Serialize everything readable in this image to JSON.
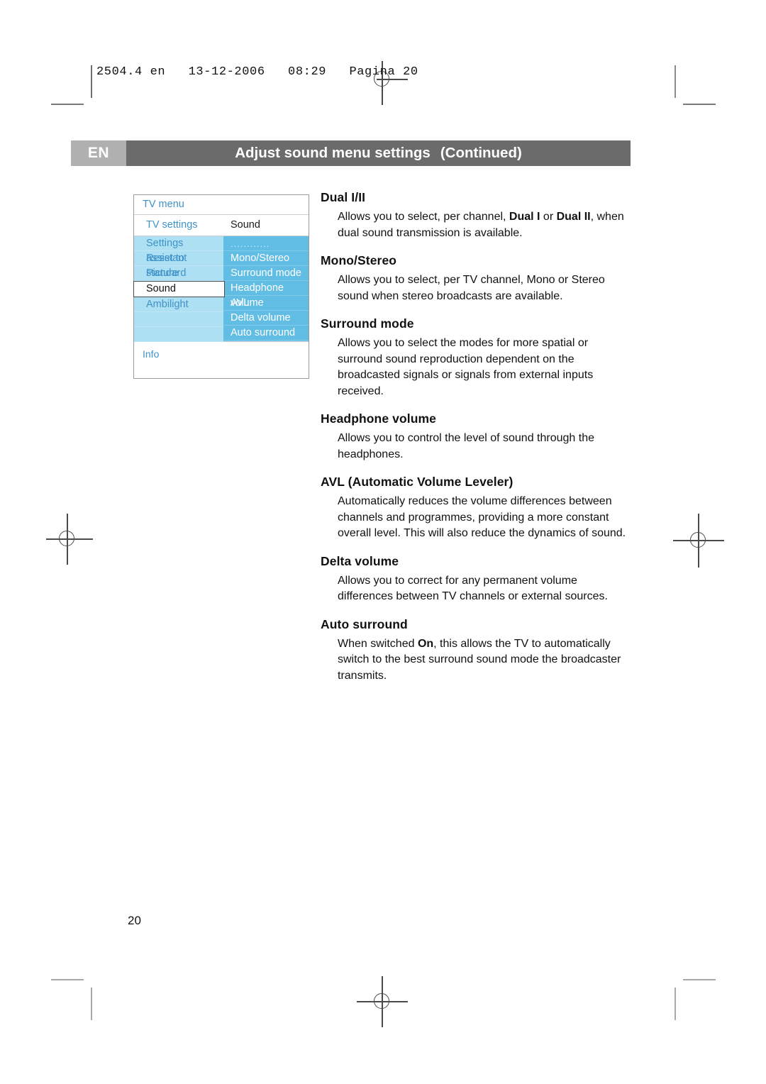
{
  "print_header": "2504.4 en   13-12-2006   08:29   Pagina 20",
  "titlebar": {
    "language": "EN",
    "title": "Adjust sound menu settings",
    "continued": "(Continued)",
    "lang_bg": "#b0b0b0",
    "title_bg": "#6b6b6b"
  },
  "tv_menu": {
    "title": "TV menu",
    "subtitle_left": "TV settings",
    "subtitle_right": "Sound",
    "left_items": [
      {
        "label": "Settings assistant",
        "selected": false
      },
      {
        "label": "Reset to standard",
        "selected": false
      },
      {
        "label": "Picture",
        "selected": false
      },
      {
        "label": "Sound",
        "selected": true
      },
      {
        "label": "Ambilight",
        "selected": false
      },
      {
        "label": "",
        "selected": false
      },
      {
        "label": "",
        "selected": false
      }
    ],
    "right_items": [
      {
        "label": "............",
        "dots": true
      },
      {
        "label": "Mono/Stereo",
        "dots": false
      },
      {
        "label": "Surround mode",
        "dots": false
      },
      {
        "label": "Headphone volume",
        "dots": false
      },
      {
        "label": "AVL",
        "dots": false
      },
      {
        "label": "Delta volume",
        "dots": false
      },
      {
        "label": "Auto surround",
        "dots": false
      }
    ],
    "info_label": "Info",
    "colors": {
      "left_bg": "#ade0f2",
      "right_bg": "#62bde4",
      "link_text": "#3f93c9"
    }
  },
  "sections": [
    {
      "heading": "Dual I/II",
      "body_html": "Allows you to select, per channel, <b>Dual I</b> or <b>Dual II</b>, when dual sound transmission is available."
    },
    {
      "heading": "Mono/Stereo",
      "body_html": "Allows you to select, per TV channel, Mono or Stereo sound when stereo broadcasts are available."
    },
    {
      "heading": "Surround mode",
      "body_html": "Allows you to select the modes for more spatial or surround sound reproduction dependent on the broadcasted signals or signals from external inputs received."
    },
    {
      "heading": "Headphone volume",
      "body_html": "Allows you to control the level of sound through the headphones."
    },
    {
      "heading": "AVL (Automatic Volume Leveler)",
      "body_html": "Automatically reduces the volume differences between channels and programmes, providing a more constant overall level. This will also reduce the dynamics of sound."
    },
    {
      "heading": "Delta volume",
      "body_html": "Allows you to correct for any permanent volume differences between TV channels or external sources."
    },
    {
      "heading": "Auto surround",
      "body_html": "When switched <b>On</b>, this allows the TV to automatically switch to the best surround sound mode the broadcaster transmits."
    }
  ],
  "page_number": "20"
}
